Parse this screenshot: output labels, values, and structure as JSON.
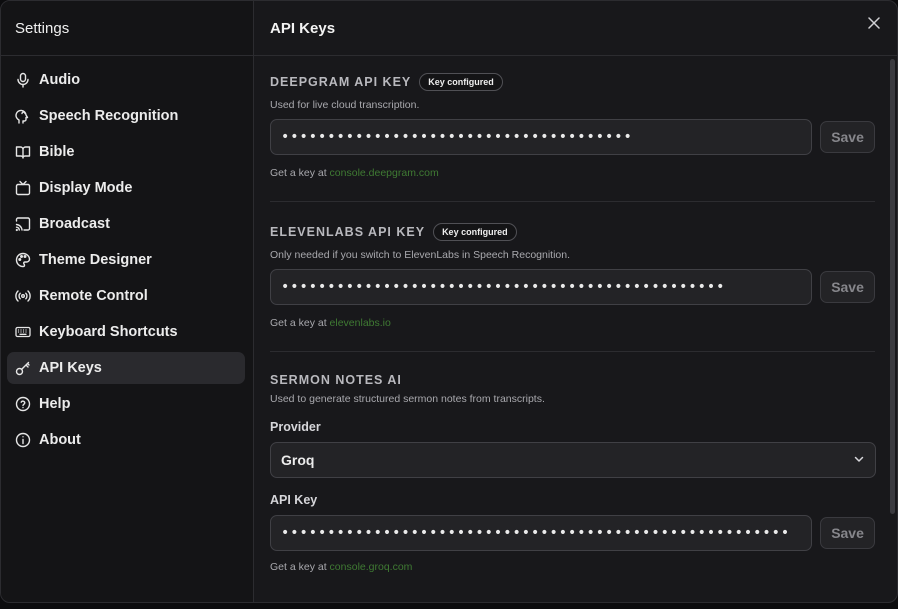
{
  "sidebar": {
    "title": "Settings",
    "items": [
      {
        "label": "Audio",
        "icon": "microphone-icon"
      },
      {
        "label": "Speech Recognition",
        "icon": "speech-head-icon"
      },
      {
        "label": "Bible",
        "icon": "book-open-icon"
      },
      {
        "label": "Display Mode",
        "icon": "tv-icon"
      },
      {
        "label": "Broadcast",
        "icon": "cast-icon"
      },
      {
        "label": "Theme Designer",
        "icon": "palette-icon"
      },
      {
        "label": "Remote Control",
        "icon": "radio-signal-icon"
      },
      {
        "label": "Keyboard Shortcuts",
        "icon": "keyboard-icon"
      },
      {
        "label": "API Keys",
        "icon": "key-icon",
        "active": true
      },
      {
        "label": "Help",
        "icon": "help-circle-icon"
      },
      {
        "label": "About",
        "icon": "info-circle-icon"
      }
    ]
  },
  "main": {
    "title": "API Keys",
    "deepgram": {
      "title": "DEEPGRAM API KEY",
      "badge": "Key configured",
      "desc": "Used for live cloud transcription.",
      "value": "••••••••••••••••••••••••••••••••••••••",
      "save": "Save",
      "hint_prefix": "Get a key at",
      "hint_link": "console.deepgram.com"
    },
    "elevenlabs": {
      "title": "ELEVENLABS API KEY",
      "badge": "Key configured",
      "desc": "Only needed if you switch to ElevenLabs in Speech Recognition.",
      "value": "••••••••••••••••••••••••••••••••••••••••••••••••",
      "save": "Save",
      "hint_prefix": "Get a key at",
      "hint_link": "elevenlabs.io"
    },
    "sermon": {
      "title": "SERMON NOTES AI",
      "desc": "Used to generate structured sermon notes from transcripts.",
      "provider_label": "Provider",
      "provider_value": "Groq",
      "key_label": "API Key",
      "value": "•••••••••••••••••••••••••••••••••••••••••••••••••••••••",
      "save": "Save",
      "hint_prefix": "Get a key at",
      "hint_link": "console.groq.com"
    }
  },
  "colors": {
    "background": "#18181b",
    "active_item": "#2a2a2e",
    "link": "#3f7a33"
  }
}
